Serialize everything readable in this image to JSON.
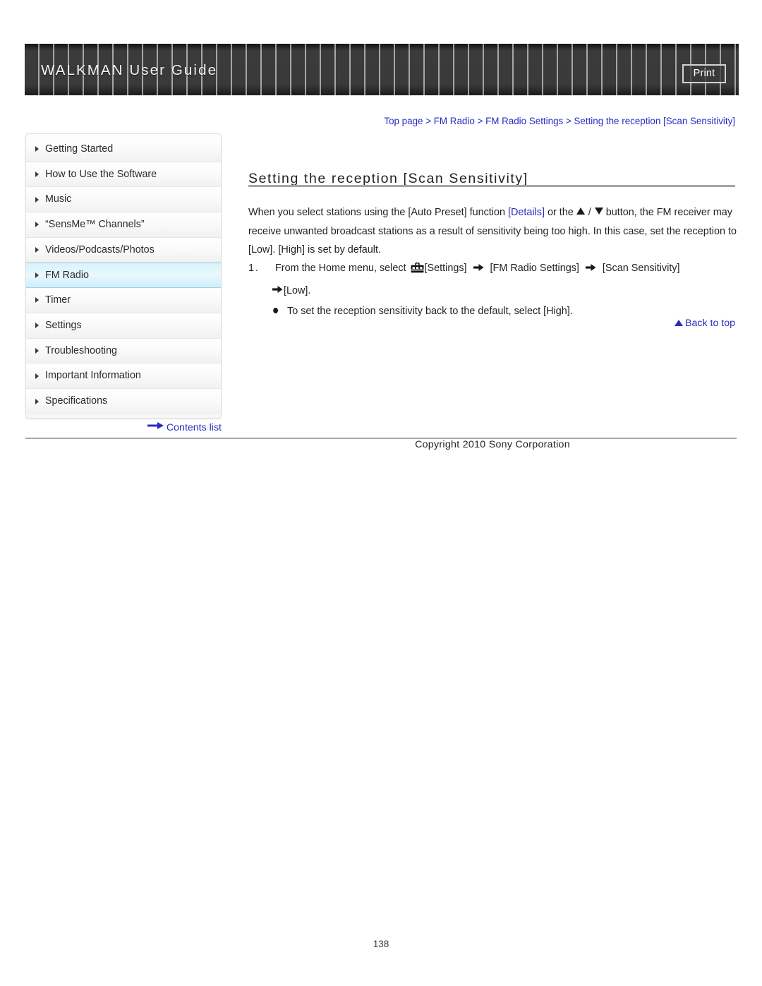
{
  "header": {
    "title": "WALKMAN User Guide",
    "print_label": "Print"
  },
  "breadcrumb": {
    "separator": " > ",
    "items": [
      "Top page",
      "FM Radio",
      "FM Radio Settings",
      "Setting the reception [Scan Sensitivity]"
    ],
    "full_text": "Top page > FM Radio > FM Radio Settings > Setting the reception [Scan Sensitivity]"
  },
  "sidebar": {
    "items": [
      {
        "label": "Getting Started",
        "active": false
      },
      {
        "label": "How to Use the Software",
        "active": false
      },
      {
        "label": "Music",
        "active": false
      },
      {
        "label": "“SensMe™ Channels”",
        "active": false
      },
      {
        "label": "Videos/Podcasts/Photos",
        "active": false
      },
      {
        "label": "FM Radio",
        "active": true
      },
      {
        "label": "Timer",
        "active": false
      },
      {
        "label": "Settings",
        "active": false
      },
      {
        "label": "Troubleshooting",
        "active": false
      },
      {
        "label": "Important Information",
        "active": false
      },
      {
        "label": "Specifications",
        "active": false
      }
    ],
    "contents_link": "Contents list"
  },
  "main": {
    "page_title": "Setting the reception [Scan Sensitivity]",
    "paragraph": {
      "part1": "When you select stations using the [Auto Preset] function ",
      "link": "[Details]",
      "part2": " or the ",
      "part3": " button, the FM receiver may receive unwanted broadcast stations as a result of sensitivity being too high. In this case, set the reception to [Low]. [High] is set by default.",
      "separator_slash": "/"
    },
    "steps": [
      {
        "number": "1.",
        "text_before_icon": "From the Home menu, select ",
        "icon": "toolbox-icon",
        "segments": [
          "[Settings]",
          "[FM Radio Settings]",
          "[Scan Sensitivity]"
        ],
        "continuation": "[Low].",
        "note": "To set the reception sensitivity back to the default, select [High]."
      }
    ],
    "back_to_top": "Back to top"
  },
  "footer": {
    "copyright": "Copyright 2010 Sony Corporation",
    "page_number": "138"
  },
  "colors": {
    "link_blue": "#2b2bc4",
    "active_nav": "#d9f3fb",
    "text": "#231f20",
    "rule_gray": "#a5a5a5"
  }
}
